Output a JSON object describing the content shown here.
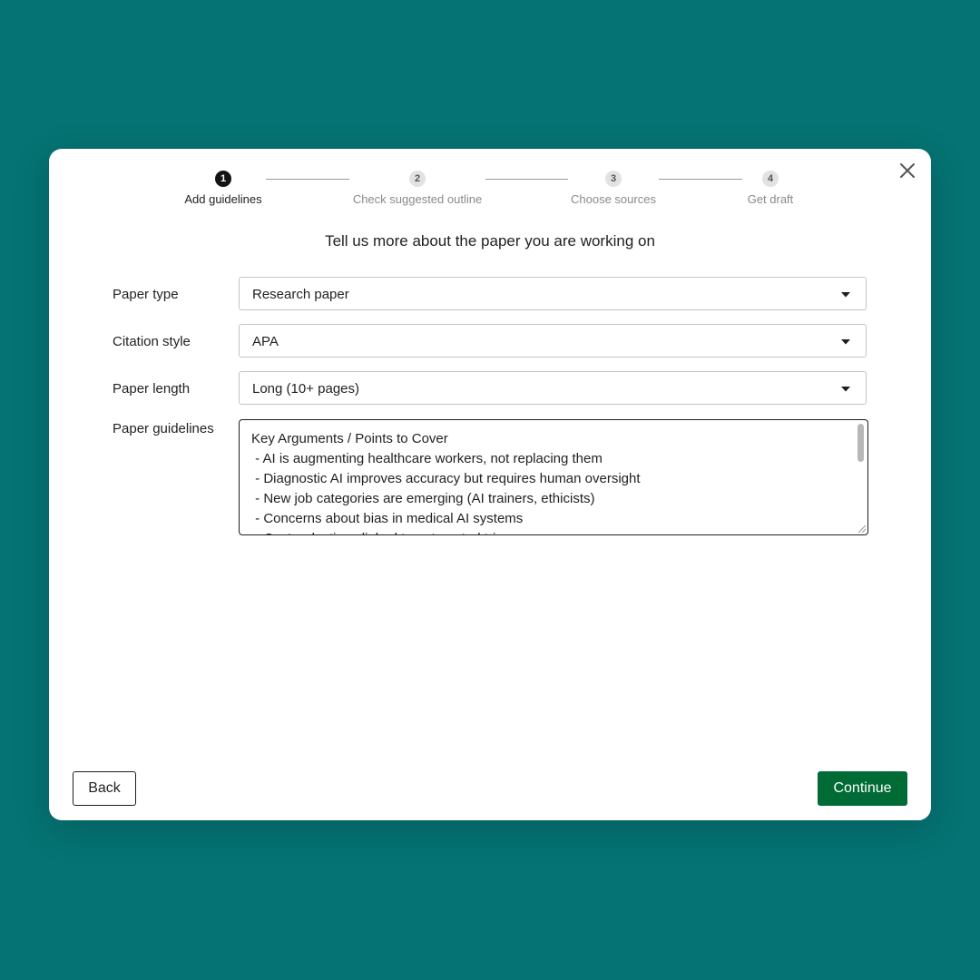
{
  "stepper": {
    "steps": [
      {
        "number": "1",
        "label": "Add guidelines",
        "active": true
      },
      {
        "number": "2",
        "label": "Check suggested outline",
        "active": false
      },
      {
        "number": "3",
        "label": "Choose sources",
        "active": false
      },
      {
        "number": "4",
        "label": "Get draft",
        "active": false
      }
    ]
  },
  "heading": "Tell us more about the paper you are working on",
  "form": {
    "paper_type": {
      "label": "Paper type",
      "value": "Research paper"
    },
    "citation_style": {
      "label": "Citation style",
      "value": "APA"
    },
    "paper_length": {
      "label": "Paper length",
      "value": "Long (10+ pages)"
    },
    "paper_guidelines": {
      "label": "Paper guidelines",
      "value": "Key Arguments / Points to Cover\n - AI is augmenting healthcare workers, not replacing them\n - Diagnostic AI improves accuracy but requires human oversight\n - New job categories are emerging (AI trainers, ethicists)\n - Concerns about bias in medical AI systems\n - Cost reductions linked to automated triage"
    }
  },
  "footer": {
    "back_label": "Back",
    "continue_label": "Continue"
  },
  "icons": {
    "close": "close-icon",
    "dropdown": "caret-down-icon"
  },
  "colors": {
    "background": "#057373",
    "primary_button": "#006b35",
    "active_step": "#141414"
  }
}
